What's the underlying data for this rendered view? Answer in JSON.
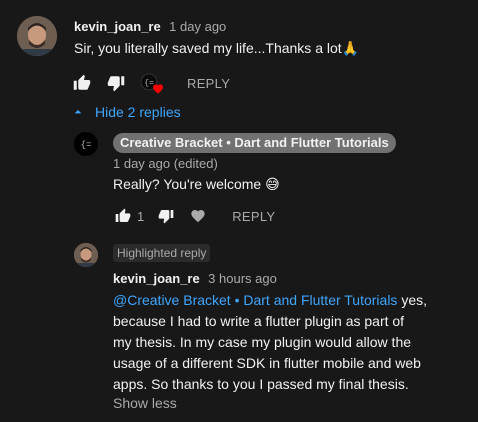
{
  "comment": {
    "author": "kevin_joan_re",
    "time": "1 day ago",
    "text": "Sir, you literally saved my life...Thanks a lot",
    "emoji": "🙏",
    "reply_label": "REPLY"
  },
  "replies_toggle": {
    "label": "Hide 2 replies"
  },
  "reply1": {
    "author": "Creative Bracket • Dart and Flutter Tutorials",
    "time": "1 day ago (edited)",
    "text": "Really? You're welcome",
    "emoji": "😅",
    "like_count": "1",
    "reply_label": "REPLY"
  },
  "reply2": {
    "badge": "Highlighted reply",
    "author": "kevin_joan_re",
    "time": "3 hours ago",
    "mention": "@Creative Bracket • Dart and Flutter Tutorials",
    "text_lines": [
      " yes,",
      "because I had to write a flutter plugin as part of",
      "my thesis. In my case my plugin would allow the",
      "usage of a different SDK in flutter mobile and web",
      "apps. So thanks to you I passed my final thesis."
    ],
    "show_less": "Show less"
  },
  "colors": {
    "background": "#181818",
    "link": "#3ea6ff",
    "heart": "#ff0000",
    "badge": "#717171"
  }
}
